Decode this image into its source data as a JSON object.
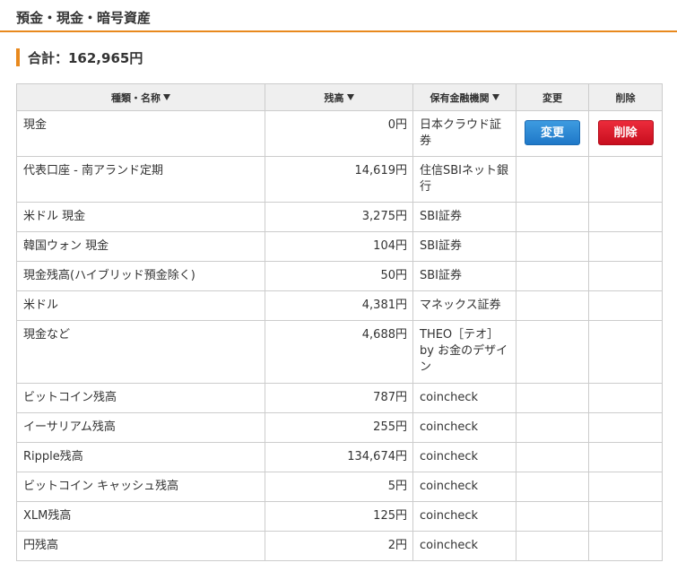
{
  "page": {
    "title": "預金・現金・暗号資産",
    "total_text": "合計：162,965円"
  },
  "table": {
    "headers": {
      "type_name": "種類・名称",
      "balance": "残高",
      "institution": "保有金融機関",
      "change": "変更",
      "delete": "削除"
    },
    "buttons": {
      "change_label": "変更",
      "delete_label": "削除"
    },
    "rows": [
      {
        "name": "現金",
        "amount": "0円",
        "institution": "日本クラウド証券"
      },
      {
        "name": "代表口座 - 南アランド定期",
        "amount": "14,619円",
        "institution": "住信SBIネット銀行"
      },
      {
        "name": "米ドル 現金",
        "amount": "3,275円",
        "institution": "SBI証券"
      },
      {
        "name": "韓国ウォン 現金",
        "amount": "104円",
        "institution": "SBI証券"
      },
      {
        "name": "現金残高(ハイブリッド預金除く)",
        "amount": "50円",
        "institution": "SBI証券"
      },
      {
        "name": "米ドル",
        "amount": "4,381円",
        "institution": "マネックス証券"
      },
      {
        "name": "現金など",
        "amount": "4,688円",
        "institution": "THEO［テオ］by お金のデザイン"
      },
      {
        "name": "ビットコイン残高",
        "amount": "787円",
        "institution": "coincheck"
      },
      {
        "name": "イーサリアム残高",
        "amount": "255円",
        "institution": "coincheck"
      },
      {
        "name": "Ripple残高",
        "amount": "134,674円",
        "institution": "coincheck"
      },
      {
        "name": "ビットコイン キャッシュ残高",
        "amount": "5円",
        "institution": "coincheck"
      },
      {
        "name": "XLM残高",
        "amount": "125円",
        "institution": "coincheck"
      },
      {
        "name": "円残高",
        "amount": "2円",
        "institution": "coincheck"
      }
    ]
  }
}
